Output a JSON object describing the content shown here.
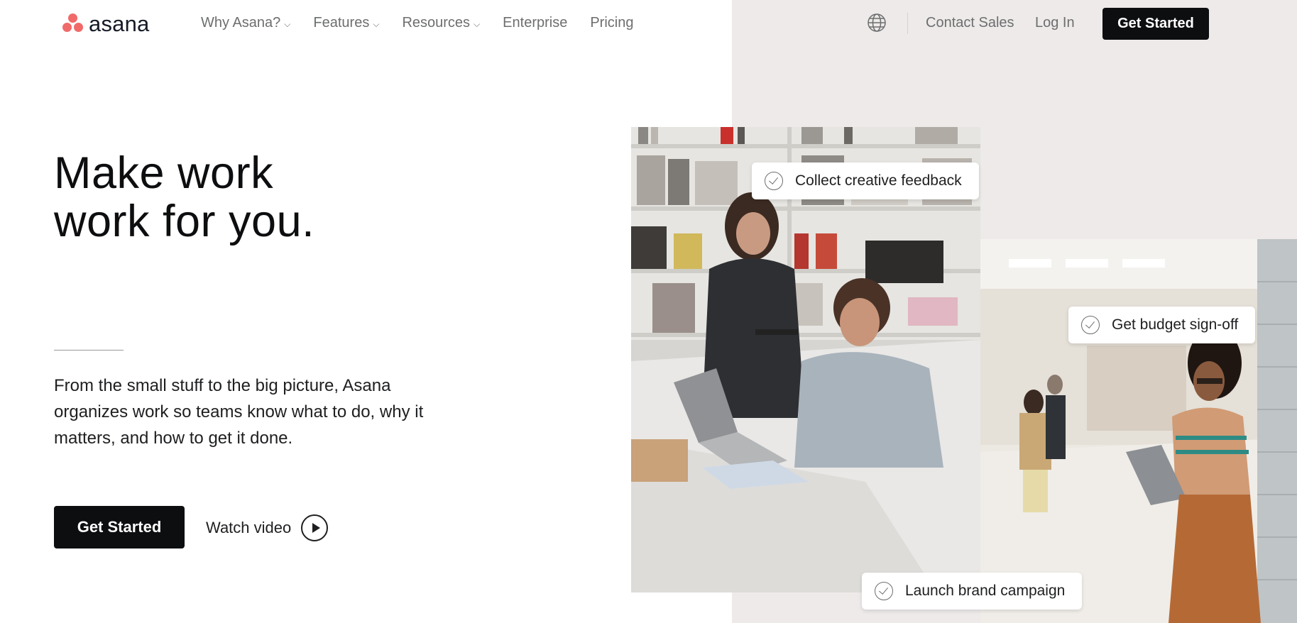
{
  "brand": {
    "name": "asana",
    "accent": "#f06a6a"
  },
  "nav": {
    "links": [
      {
        "label": "Why Asana?",
        "has_dropdown": true
      },
      {
        "label": "Features",
        "has_dropdown": true
      },
      {
        "label": "Resources",
        "has_dropdown": true
      },
      {
        "label": "Enterprise",
        "has_dropdown": false
      },
      {
        "label": "Pricing",
        "has_dropdown": false
      }
    ],
    "language_icon": "globe-icon",
    "contact_sales": "Contact Sales",
    "log_in": "Log In",
    "cta": "Get Started"
  },
  "hero": {
    "headline_line1": "Make work",
    "headline_line2": "work for you.",
    "subtext": "From the small stuff to the big picture, Asana organizes work so teams know what to do, why it matters, and how to get it done.",
    "cta": "Get Started",
    "watch_video": "Watch video"
  },
  "task_cards": [
    {
      "label": "Collect creative feedback"
    },
    {
      "label": "Get budget sign-off"
    },
    {
      "label": "Launch brand campaign"
    }
  ],
  "colors": {
    "panel_bg": "#edeae9",
    "button_bg": "#0d0e10",
    "text_muted": "#6d6e6f"
  }
}
